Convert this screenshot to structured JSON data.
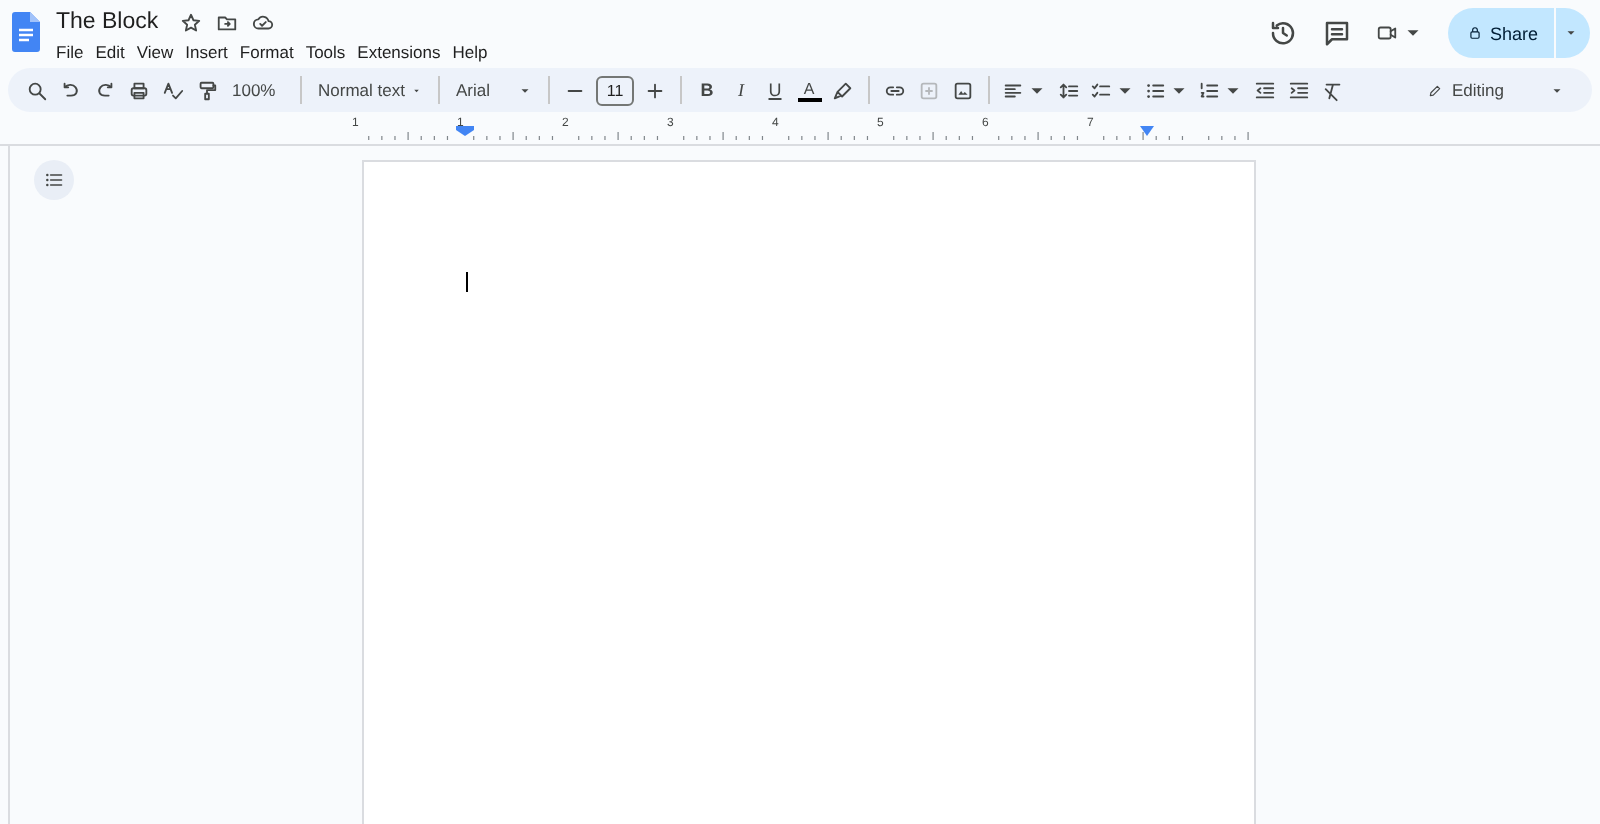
{
  "document": {
    "title": "The Block"
  },
  "menu": [
    {
      "label": "File"
    },
    {
      "label": "Edit"
    },
    {
      "label": "View"
    },
    {
      "label": "Insert"
    },
    {
      "label": "Format"
    },
    {
      "label": "Tools"
    },
    {
      "label": "Extensions"
    },
    {
      "label": "Help"
    }
  ],
  "share": {
    "label": "Share"
  },
  "toolbar": {
    "zoom": "100%",
    "style": "Normal text",
    "font": "Arial",
    "font_size": "11",
    "bold": "B",
    "italic": "I",
    "underline": "U",
    "text_color": "A",
    "mode": "Editing"
  },
  "ruler": {
    "labels": [
      "1",
      "1",
      "2",
      "3",
      "4",
      "5",
      "6",
      "7"
    ]
  }
}
